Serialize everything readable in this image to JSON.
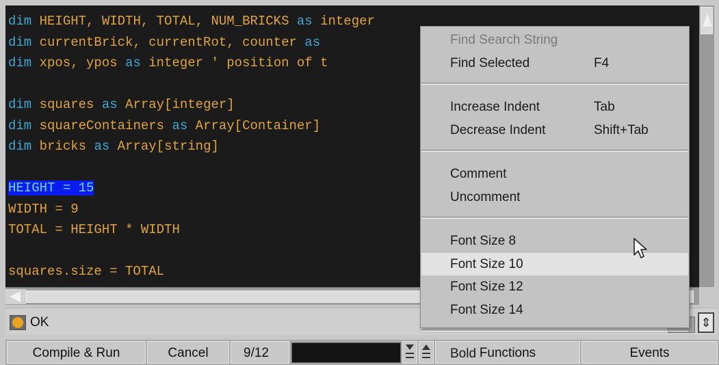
{
  "editor": {
    "lines": [
      [
        {
          "t": "dim",
          "c": "kw"
        },
        {
          "t": " HEIGHT, WIDTH, TOTAL, NUM_BRICKS "
        },
        {
          "t": "as",
          "c": "kw"
        },
        {
          "t": " integer"
        }
      ],
      [
        {
          "t": "dim",
          "c": "kw"
        },
        {
          "t": " currentBrick, currentRot, counter "
        },
        {
          "t": "as",
          "c": "kw"
        }
      ],
      [
        {
          "t": "dim",
          "c": "kw"
        },
        {
          "t": " xpos, ypos "
        },
        {
          "t": "as",
          "c": "kw"
        },
        {
          "t": " integer ' position of t"
        }
      ],
      [],
      [
        {
          "t": "dim",
          "c": "kw"
        },
        {
          "t": " squares "
        },
        {
          "t": "as",
          "c": "kw"
        },
        {
          "t": " Array[integer]"
        }
      ],
      [
        {
          "t": "dim",
          "c": "kw"
        },
        {
          "t": " squareContainers "
        },
        {
          "t": "as",
          "c": "kw"
        },
        {
          "t": " Array[Container]"
        }
      ],
      [
        {
          "t": "dim",
          "c": "kw"
        },
        {
          "t": " bricks "
        },
        {
          "t": "as",
          "c": "kw"
        },
        {
          "t": " Array[string]"
        }
      ],
      [],
      [
        {
          "t": "HEIGHT = 15",
          "c": "hl"
        }
      ],
      [
        {
          "t": "WIDTH = 9"
        }
      ],
      [
        {
          "t": "TOTAL = HEIGHT * WIDTH"
        }
      ],
      [],
      [
        {
          "t": "squares.size = TOTAL"
        }
      ]
    ]
  },
  "status": {
    "icon": "script-status-icon",
    "text": "OK",
    "toggle_icon": "up-down-arrows-icon",
    "toggle_glyph": "⇕"
  },
  "toolbar": {
    "compile_run": "Compile & Run",
    "cancel": "Cancel",
    "progress_text": "9/12",
    "functions": "Functions",
    "events": "Events"
  },
  "context_menu": {
    "items": [
      {
        "label": "Find Search String",
        "shortcut": "",
        "disabled": true
      },
      {
        "label": "Find Selected",
        "shortcut": "F4"
      },
      {
        "sep": true
      },
      {
        "label": "Increase Indent",
        "shortcut": "Tab"
      },
      {
        "label": "Decrease Indent",
        "shortcut": "Shift+Tab"
      },
      {
        "sep": true
      },
      {
        "label": "Comment",
        "shortcut": ""
      },
      {
        "label": "Uncomment",
        "shortcut": ""
      },
      {
        "sep": true
      },
      {
        "label": "Font Size 8",
        "shortcut": ""
      },
      {
        "label": "Font Size 10",
        "shortcut": "",
        "hover": true
      },
      {
        "label": "Font Size 12",
        "shortcut": ""
      },
      {
        "label": "Font Size 14",
        "shortcut": ""
      },
      {
        "sep": true
      },
      {
        "label": "Bold",
        "shortcut": ""
      }
    ]
  },
  "colors": {
    "editor_bg": "#1b1b1b",
    "code_text": "#e0a43c",
    "keyword": "#3fa8d2",
    "selection": "#0b1cf0",
    "menu_bg": "#c3c3c3",
    "menu_hover": "#e2e2e2"
  }
}
